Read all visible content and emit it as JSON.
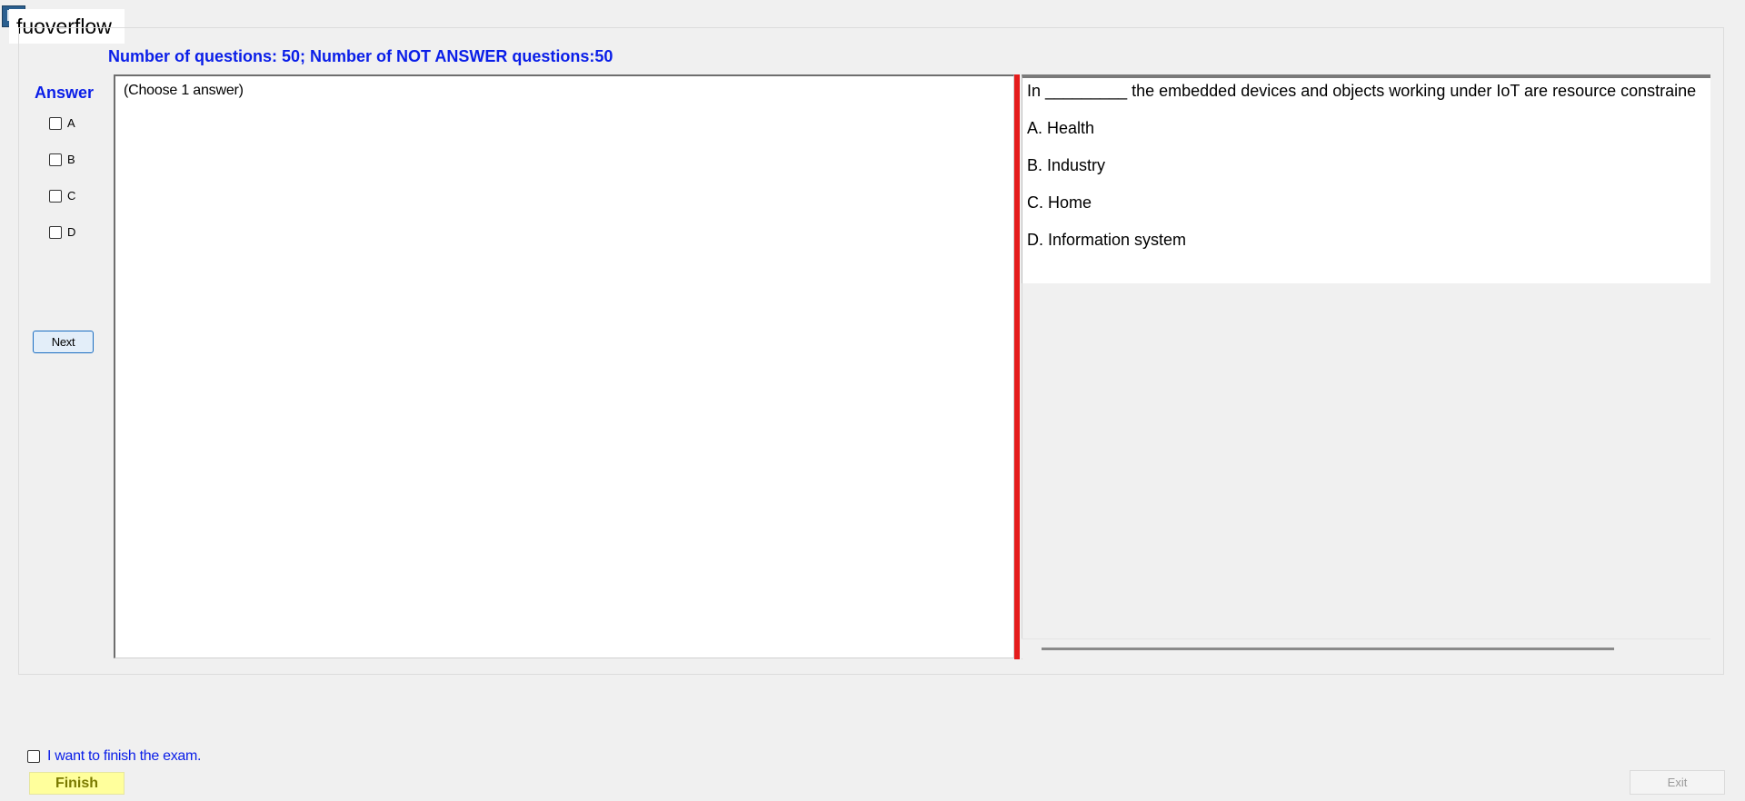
{
  "window": {
    "title": "fuoverflow"
  },
  "status": {
    "text": "Number of questions: 50; Number of NOT ANSWER questions:50"
  },
  "answer": {
    "label": "Answer",
    "options": [
      "A",
      "B",
      "C",
      "D"
    ],
    "next_label": "Next"
  },
  "answer_panel": {
    "hint": "(Choose 1 answer)"
  },
  "question": {
    "text": "In _________ the embedded devices and objects working under IoT are resource constraine",
    "choices": [
      "A.  Health",
      "B.  Industry",
      "C.  Home",
      "D.  Information system"
    ]
  },
  "footer": {
    "finish_check_label": "I want to finish the exam.",
    "finish_label": "Finish",
    "exit_label": "Exit"
  },
  "colors": {
    "accent_blue": "#0a1ee8",
    "splitter_red": "#e51c1c",
    "finish_yellow": "#ffff9c"
  }
}
